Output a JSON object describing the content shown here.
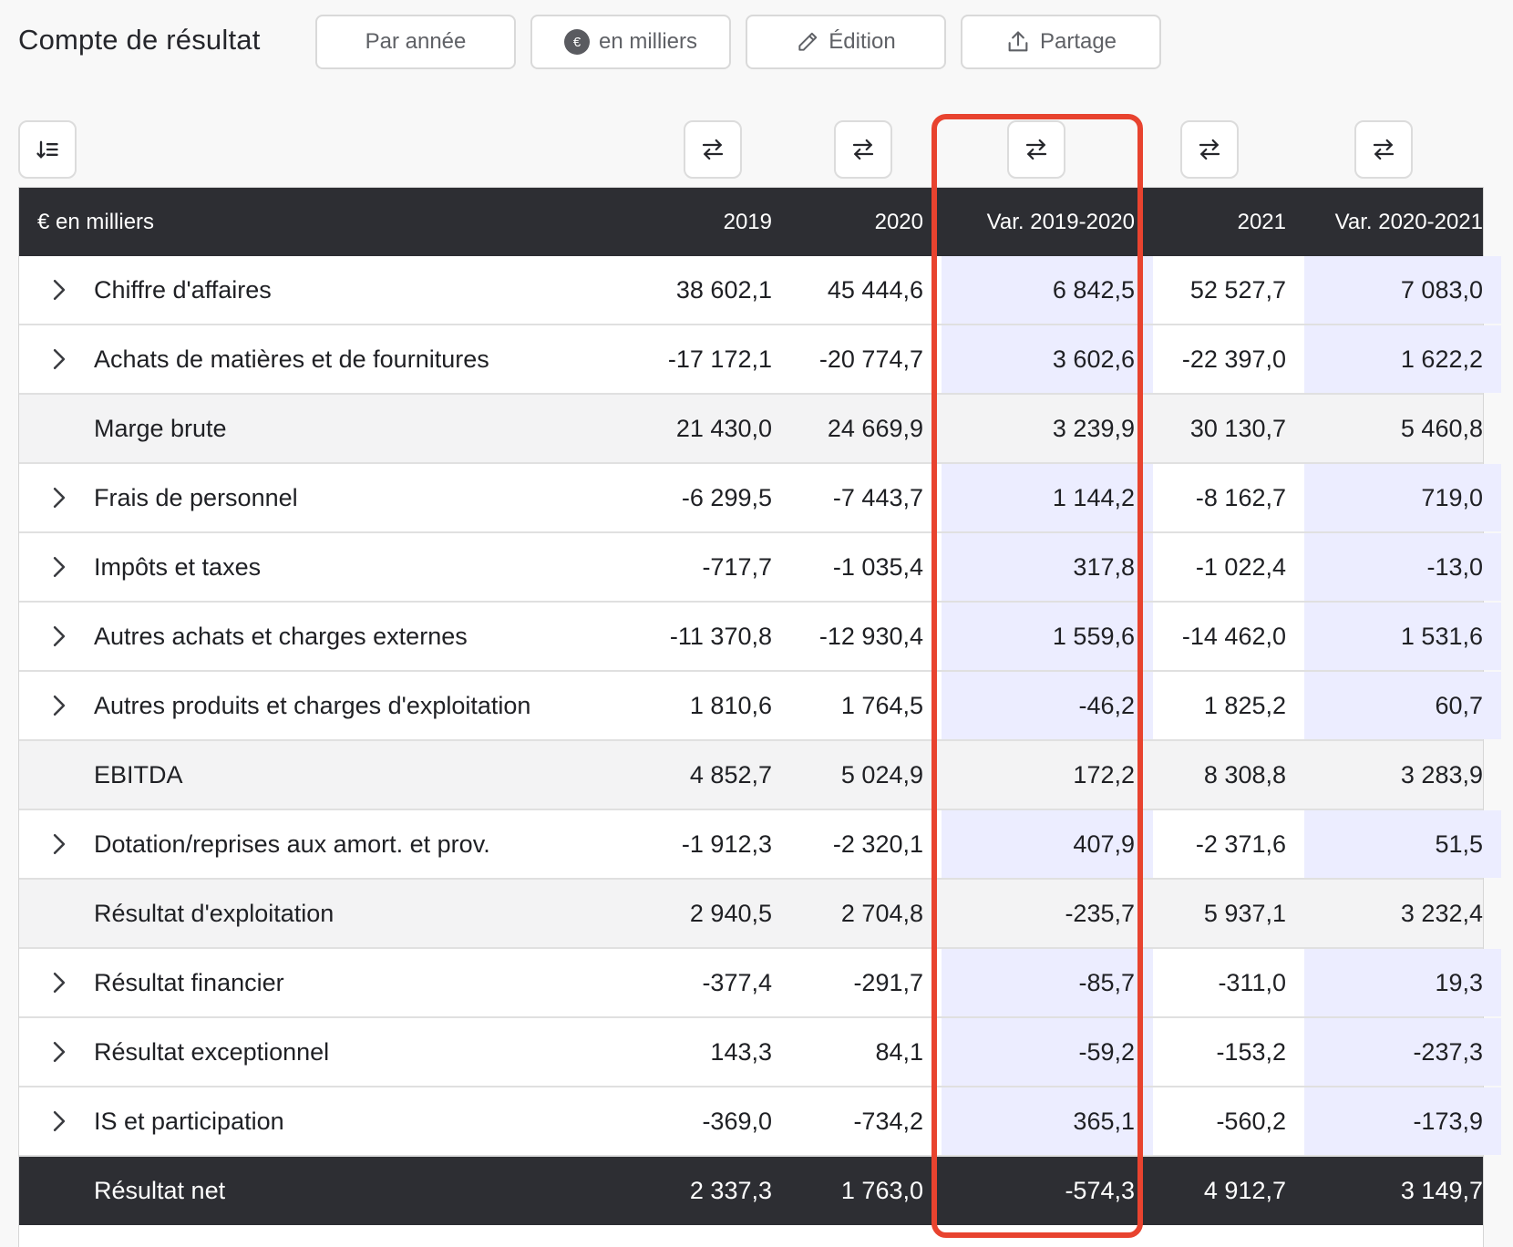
{
  "title": "Compte de résultat",
  "toolbar": {
    "period": "Par année",
    "unit_badge": "€",
    "unit": "en milliers",
    "edit": "Édition",
    "share": "Partage"
  },
  "table": {
    "headers": [
      "€ en milliers",
      "2019",
      "2020",
      "Var. 2019-2020",
      "2021",
      "Var. 2020-2021"
    ],
    "rows": [
      {
        "label": "Chiffre d'affaires",
        "v2019": "38 602,1",
        "v2020": "45 444,6",
        "var1": "6 842,5",
        "v2021": "52 527,7",
        "var2": "7 083,0"
      },
      {
        "label": "Achats de matières et de fournitures",
        "v2019": "-17 172,1",
        "v2020": "-20 774,7",
        "var1": "3 602,6",
        "v2021": "-22 397,0",
        "var2": "1 622,2"
      },
      {
        "label": "Marge brute",
        "v2019": "21 430,0",
        "v2020": "24 669,9",
        "var1": "3 239,9",
        "v2021": "30 130,7",
        "var2": "5 460,8"
      },
      {
        "label": "Frais de personnel",
        "v2019": "-6 299,5",
        "v2020": "-7 443,7",
        "var1": "1 144,2",
        "v2021": "-8 162,7",
        "var2": "719,0"
      },
      {
        "label": "Impôts et taxes",
        "v2019": "-717,7",
        "v2020": "-1 035,4",
        "var1": "317,8",
        "v2021": "-1 022,4",
        "var2": "-13,0"
      },
      {
        "label": "Autres achats et charges externes",
        "v2019": "-11 370,8",
        "v2020": "-12 930,4",
        "var1": "1 559,6",
        "v2021": "-14 462,0",
        "var2": "1 531,6"
      },
      {
        "label": "Autres produits et charges d'exploitation",
        "v2019": "1 810,6",
        "v2020": "1 764,5",
        "var1": "-46,2",
        "v2021": "1 825,2",
        "var2": "60,7"
      },
      {
        "label": "EBITDA",
        "v2019": "4 852,7",
        "v2020": "5 024,9",
        "var1": "172,2",
        "v2021": "8 308,8",
        "var2": "3 283,9"
      },
      {
        "label": "Dotation/reprises aux amort. et prov.",
        "v2019": "-1 912,3",
        "v2020": "-2 320,1",
        "var1": "407,9",
        "v2021": "-2 371,6",
        "var2": "51,5"
      },
      {
        "label": "Résultat d'exploitation",
        "v2019": "2 940,5",
        "v2020": "2 704,8",
        "var1": "-235,7",
        "v2021": "5 937,1",
        "var2": "3 232,4"
      },
      {
        "label": "Résultat financier",
        "v2019": "-377,4",
        "v2020": "-291,7",
        "var1": "-85,7",
        "v2021": "-311,0",
        "var2": "19,3"
      },
      {
        "label": "Résultat exceptionnel",
        "v2019": "143,3",
        "v2020": "84,1",
        "var1": "-59,2",
        "v2021": "-153,2",
        "var2": "-237,3"
      },
      {
        "label": "IS et participation",
        "v2019": "-369,0",
        "v2020": "-734,2",
        "var1": "365,1",
        "v2021": "-560,2",
        "var2": "-173,9"
      },
      {
        "label": "Résultat net",
        "v2019": "2 337,3",
        "v2020": "1 763,0",
        "var1": "-574,3",
        "v2021": "4 912,7",
        "var2": "3 149,7"
      }
    ]
  },
  "colors": {
    "header_bg": "#2d2e33",
    "variation_bg": "#ecedff",
    "subtotal_bg": "#f3f3f4",
    "highlight": "#e8432f"
  }
}
